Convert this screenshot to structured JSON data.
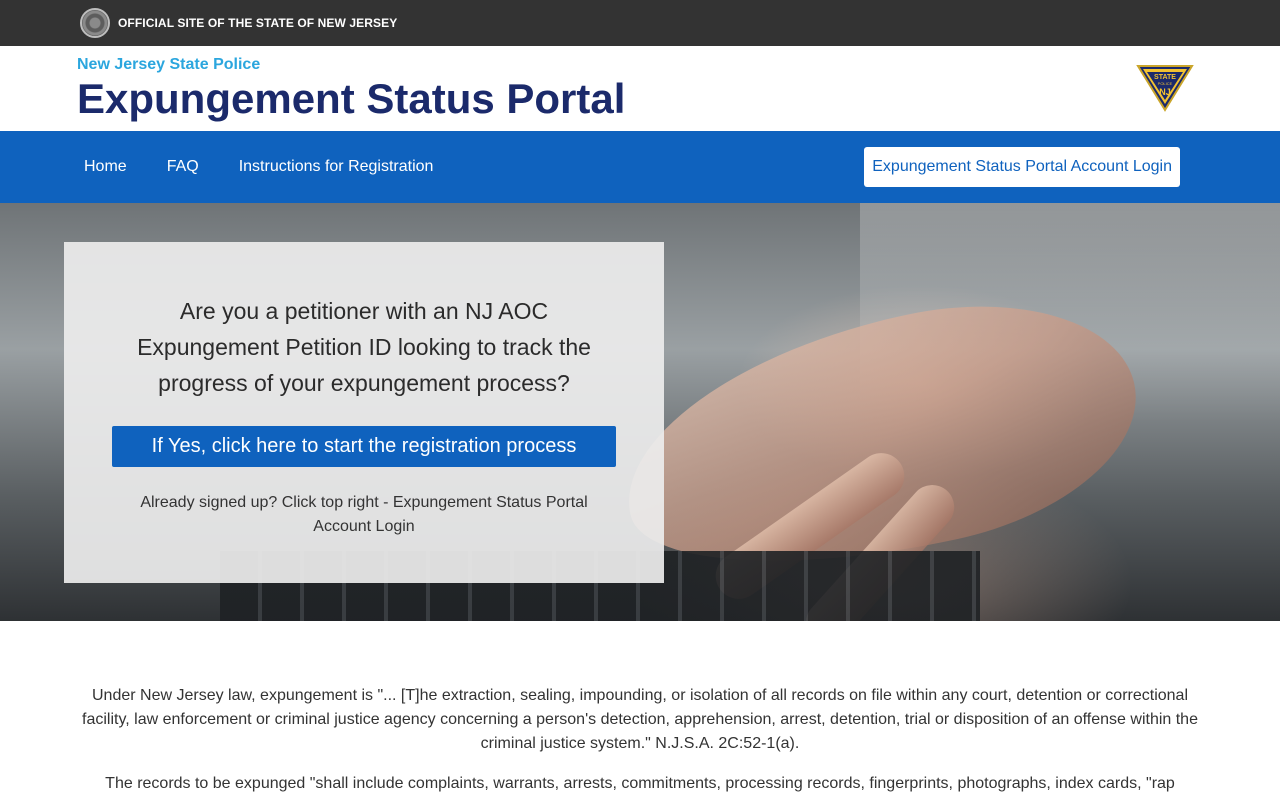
{
  "top_bar": {
    "text": "OFFICIAL SITE OF THE STATE OF NEW JERSEY"
  },
  "header": {
    "agency": "New Jersey State Police",
    "title": "Expungement Status Portal",
    "badge": {
      "line1": "STATE",
      "line2": "POLICE",
      "line3": "NJ"
    }
  },
  "nav": {
    "links": [
      "Home",
      "FAQ",
      "Instructions for Registration"
    ],
    "login_button": "Expungement Status Portal Account Login"
  },
  "hero": {
    "question": "Are you a petitioner with an NJ AOC Expungement Petition ID looking to track the progress of your expungement process?",
    "register_button": "If Yes, click here to start the registration process",
    "already_signed_up": "Already signed up? Click top right - Expungement Status Portal Account Login"
  },
  "content": {
    "paragraph1": "Under New Jersey law, expungement is \"... [T]he extraction, sealing, impounding, or isolation of all records on file within any court, detention or correctional facility, law enforcement or criminal justice agency concerning a person's detection, apprehension, arrest, detention, trial or disposition of an offense within the criminal justice system.\" N.J.S.A. 2C:52-1(a).",
    "paragraph2": "The records to be expunged \"shall include complaints, warrants, arrests, commitments, processing records, fingerprints, photographs, index cards, \"rap"
  },
  "colors": {
    "top_bar": "#333333",
    "agency": "#2ba6de",
    "title": "#1b2a6b",
    "nav": "#0f62be"
  }
}
